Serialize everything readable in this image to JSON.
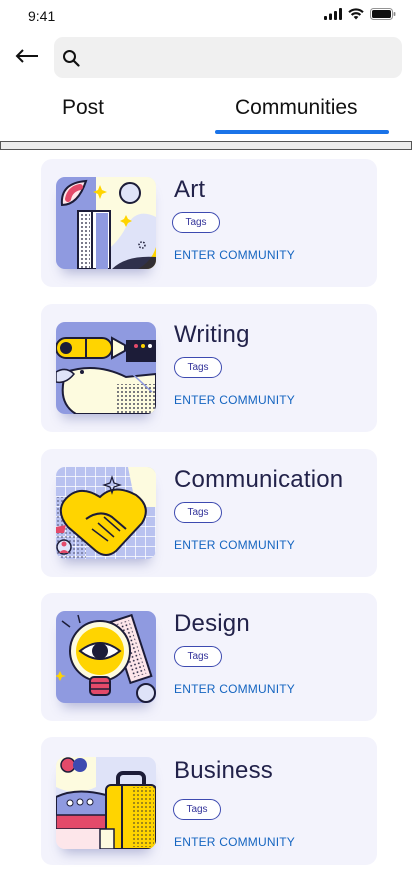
{
  "status_bar": {
    "time": "9:41"
  },
  "header": {
    "back_icon": "arrow-left-icon",
    "search": {
      "icon": "search-icon",
      "placeholder": "",
      "value": ""
    }
  },
  "tabs": [
    {
      "label": "Post",
      "active": false
    },
    {
      "label": "Communities",
      "active": true
    }
  ],
  "accent_color": "#1a73e8",
  "communities": [
    {
      "title": "Art",
      "tags_label": "Tags",
      "enter_label": "ENTER COMMUNITY"
    },
    {
      "title": "Writing",
      "tags_label": "Tags",
      "enter_label": "ENTER COMMUNITY"
    },
    {
      "title": "Communication",
      "tags_label": "Tags",
      "enter_label": "ENTER COMMUNITY"
    },
    {
      "title": "Design",
      "tags_label": "Tags",
      "enter_label": "ENTER COMMUNITY"
    },
    {
      "title": "Business",
      "tags_label": "Tags",
      "enter_label": "ENTER COMMUNITY"
    }
  ]
}
